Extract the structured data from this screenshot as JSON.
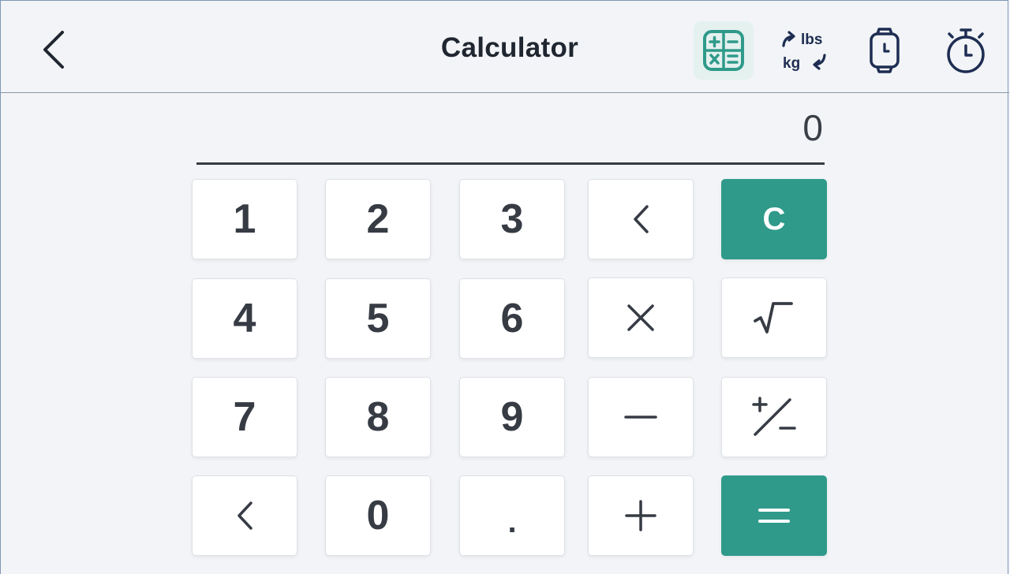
{
  "header": {
    "title": "Calculator",
    "icons": {
      "back": "chevron-left-icon",
      "calculator": "calculator-icon",
      "converter": "weight-converter-icon",
      "watch": "smartwatch-icon",
      "timer": "stopwatch-icon"
    },
    "converter_top": "lbs",
    "converter_bottom": "kg"
  },
  "display": {
    "value": "0"
  },
  "keys": {
    "row1": [
      "1",
      "2",
      "3",
      "backspace",
      "C"
    ],
    "row2": [
      "4",
      "5",
      "6",
      "multiply",
      "square-root"
    ],
    "row3": [
      "7",
      "8",
      "9",
      "minus",
      "plus-minus"
    ],
    "row4": [
      "backspace",
      "0",
      ".",
      "plus",
      "equals"
    ],
    "labels": {
      "k1": "1",
      "k2": "2",
      "k3": "3",
      "clear": "C",
      "k4": "4",
      "k5": "5",
      "k6": "6",
      "k7": "7",
      "k8": "8",
      "k9": "9",
      "k0": "0",
      "dot": "."
    }
  },
  "colors": {
    "accent": "#2f9a8a",
    "background": "#f2f4f7",
    "text": "#363b44",
    "icon_navy": "#1e2d52"
  }
}
